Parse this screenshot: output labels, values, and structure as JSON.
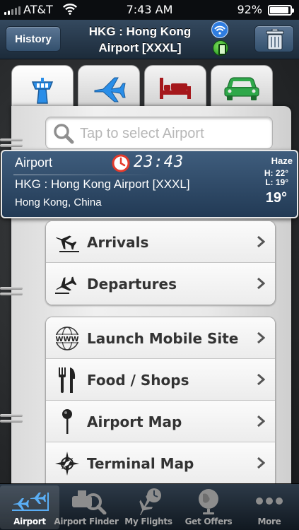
{
  "status_bar": {
    "carrier": "AT&T",
    "time": "7:43 AM",
    "battery": "92%"
  },
  "nav": {
    "history_label": "History",
    "title_line1": "HKG : Hong Kong",
    "title_line2": "Airport [XXXL]"
  },
  "category_tabs": [
    {
      "name": "airport-tower",
      "icon": "control-tower-icon",
      "active": true
    },
    {
      "name": "flights",
      "icon": "airplane-icon",
      "active": false
    },
    {
      "name": "hotels",
      "icon": "bed-icon",
      "active": false
    },
    {
      "name": "cars",
      "icon": "car-icon",
      "active": false
    }
  ],
  "search": {
    "placeholder": "Tap to select Airport"
  },
  "airport_card": {
    "label": "Airport",
    "local_time": "23:43",
    "code_name": "HKG : Hong Kong Airport [XXXL]",
    "location": "Hong Kong, China",
    "weather": "Haze",
    "high": "H: 22°",
    "low": "L: 19°",
    "temp": "19°"
  },
  "menu_group_1": [
    {
      "label": "Arrivals",
      "icon": "arrival-plane-icon"
    },
    {
      "label": "Departures",
      "icon": "departure-plane-icon"
    }
  ],
  "menu_group_2": [
    {
      "label": "Launch Mobile Site",
      "icon": "www-globe-icon"
    },
    {
      "label": "Food / Shops",
      "icon": "fork-knife-icon"
    },
    {
      "label": "Airport Map",
      "icon": "map-pin-icon"
    },
    {
      "label": "Terminal Map",
      "icon": "compass-icon"
    }
  ],
  "tab_bar": [
    {
      "label": "Airport",
      "icon": "airport-icon",
      "active": true
    },
    {
      "label": "Airport Finder",
      "icon": "airport-finder-icon",
      "active": false
    },
    {
      "label": "My Flights",
      "icon": "my-flights-icon",
      "active": false
    },
    {
      "label": "Get Offers",
      "icon": "globe-icon",
      "active": false
    },
    {
      "label": "More",
      "icon": "more-dots-icon",
      "active": false
    }
  ],
  "colors": {
    "accent": "#2f4a66",
    "tab_active_icon": "#2a8ee8",
    "hotel_red": "#a5181c",
    "car_green": "#2fa84a"
  }
}
